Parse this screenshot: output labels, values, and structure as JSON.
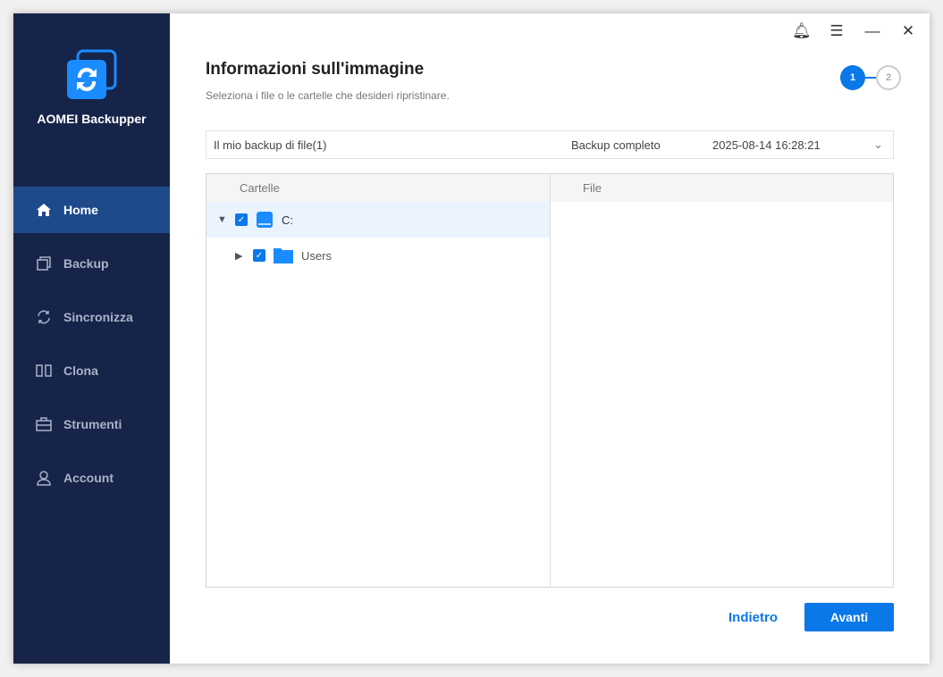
{
  "app": {
    "name": "AOMEI Backupper"
  },
  "nav": [
    {
      "label": "Home"
    },
    {
      "label": "Backup"
    },
    {
      "label": "Sincronizza"
    },
    {
      "label": "Clona"
    },
    {
      "label": "Strumenti"
    },
    {
      "label": "Account"
    }
  ],
  "header": {
    "title": "Informazioni sull'immagine",
    "subtitle": "Seleziona i file o le cartelle che desideri ripristinare.",
    "steps": [
      "1",
      "2"
    ]
  },
  "backup": {
    "name": "Il mio backup di file(1)",
    "type": "Backup completo",
    "date": "2025-08-14 16:28:21"
  },
  "tree": {
    "folders_header": "Cartelle",
    "files_header": "File",
    "items": [
      {
        "label": "C:"
      },
      {
        "label": "Users"
      }
    ]
  },
  "buttons": {
    "back": "Indietro",
    "next": "Avanti"
  },
  "colors": {
    "accent": "#0a78e8",
    "sidebar": "#17244a"
  }
}
